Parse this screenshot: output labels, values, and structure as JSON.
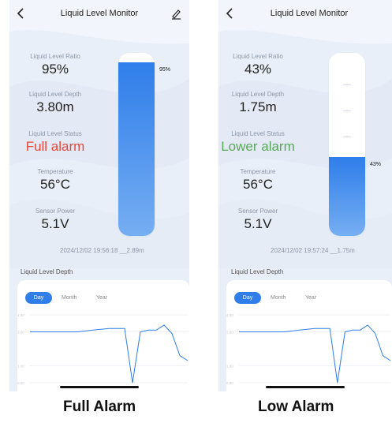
{
  "screens": [
    {
      "title": "Liquid Level Monitor",
      "ratio_label": "Liquid Level Ratio",
      "ratio_value": "95%",
      "depth_label": "Liquid Level Depth",
      "depth_value": "3.80m",
      "status_label": "Liquid Level Status",
      "status_value": "Full alarm",
      "status_color": "#e8483b",
      "temp_label": "Temperature",
      "temp_value": "56°C",
      "power_label": "Sensor Power",
      "power_value": "5.1V",
      "tank_level_fraction": 0.95,
      "tank_percent_text": "95%",
      "timestamp": "2024/12/02 19:56:18 __2.89m",
      "section_title": "Liquid Level Depth",
      "tabs": [
        "Day",
        "Month",
        "Year"
      ],
      "active_tab": "Day",
      "chart_data": {
        "type": "line",
        "title": "",
        "xlabel": "",
        "ylabel": "",
        "ylim": [
          0,
          4
        ],
        "yticks": [
          "4.00",
          "3.00",
          "1.00",
          "0.00"
        ],
        "x": [
          0,
          1,
          2,
          3,
          4,
          5,
          6,
          6.5,
          7,
          7.5,
          8,
          8.5,
          9,
          9.5,
          10
        ],
        "values": [
          3.0,
          3.0,
          3.0,
          3.0,
          3.1,
          3.2,
          3.2,
          0.0,
          3.0,
          3.1,
          3.1,
          3.4,
          2.9,
          1.6,
          1.3
        ]
      },
      "caption": "Full Alarm"
    },
    {
      "title": "Liquid Level Monitor",
      "ratio_label": "Liquid Level Ratio",
      "ratio_value": "43%",
      "depth_label": "Liquid Level Depth",
      "depth_value": "1.75m",
      "status_label": "Liquid Level Status",
      "status_value": "Lower alarm",
      "status_color": "#5aa85a",
      "temp_label": "Temperature",
      "temp_value": "56°C",
      "power_label": "Sensor Power",
      "power_value": "5.1V",
      "tank_level_fraction": 0.43,
      "tank_percent_text": "43%",
      "timestamp": "2024/12/02 19:57:24 __1.75m",
      "section_title": "Liquid Level Depth",
      "tabs": [
        "Day",
        "Month",
        "Year"
      ],
      "active_tab": "Day",
      "chart_data": {
        "type": "line",
        "title": "",
        "xlabel": "",
        "ylabel": "",
        "ylim": [
          0,
          4
        ],
        "yticks": [
          "4.00",
          "3.00",
          "1.00",
          "0.00"
        ],
        "x": [
          0,
          1,
          2,
          3,
          4,
          5,
          6,
          6.5,
          7,
          7.5,
          8,
          8.5,
          9,
          9.5,
          10
        ],
        "values": [
          3.0,
          3.0,
          3.0,
          3.0,
          3.1,
          3.2,
          3.2,
          0.0,
          3.0,
          3.1,
          3.1,
          3.4,
          2.9,
          1.6,
          1.3
        ]
      },
      "caption": "Low Alarm"
    }
  ]
}
